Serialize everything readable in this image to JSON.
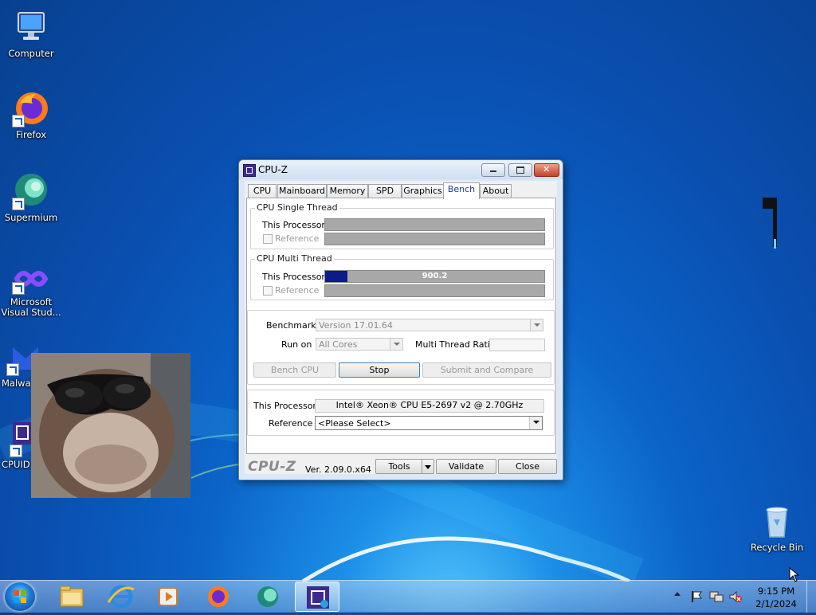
{
  "desktop": {
    "icons": [
      {
        "label": "Computer"
      },
      {
        "label": "Firefox"
      },
      {
        "label": "Supermium"
      },
      {
        "label": "Microsoft Visual Stud..."
      },
      {
        "label": "Malwa"
      },
      {
        "label": "CPUID"
      },
      {
        "label": "Recycle Bin"
      }
    ]
  },
  "window": {
    "title": "CPU-Z",
    "tabs": [
      "CPU",
      "Mainboard",
      "Memory",
      "SPD",
      "Graphics",
      "Bench",
      "About"
    ],
    "active_tab": "Bench",
    "single_thread": {
      "group_title": "CPU Single Thread",
      "this_processor_label": "This Processor",
      "reference_label": "Reference"
    },
    "multi_thread": {
      "group_title": "CPU Multi Thread",
      "this_processor_label": "This Processor",
      "this_processor_value": "900.2",
      "this_processor_fill_fraction": 0.1,
      "reference_label": "Reference"
    },
    "settings": {
      "benchmark_label": "Benchmark",
      "benchmark_value": "Version 17.01.64",
      "run_on_label": "Run on",
      "run_on_value": "All Cores",
      "multi_thread_ratio_label": "Multi Thread Ratio",
      "bench_cpu_button": "Bench CPU",
      "stop_button": "Stop",
      "submit_button": "Submit and Compare"
    },
    "compare": {
      "this_processor_label": "This Processor",
      "this_processor_value": "Intel® Xeon® CPU E5-2697 v2 @ 2.70GHz",
      "reference_label": "Reference",
      "reference_value": "<Please Select>"
    },
    "footer": {
      "logo": "CPU-Z",
      "version": "Ver. 2.09.0.x64",
      "tools_button": "Tools",
      "validate_button": "Validate",
      "close_button": "Close"
    }
  },
  "taskbar": {
    "time": "9:15 PM",
    "date": "2/1/2024"
  },
  "colors": {
    "bench_fill": "#0c1b8a",
    "bar_bg": "#a8a8a8"
  }
}
